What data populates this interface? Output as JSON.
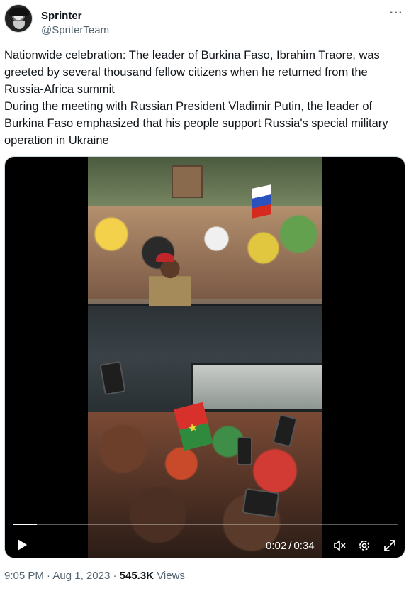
{
  "author": {
    "display_name": "Sprinter",
    "handle": "@SpriterTeam"
  },
  "tweet": {
    "paragraph_1": "Nationwide celebration: The leader of Burkina Faso, Ibrahim Traore, was greeted by several thousand fellow citizens when he returned from the Russia-Africa summit",
    "paragraph_2": "During the meeting with Russian President Vladimir Putin, the leader of Burkina Faso emphasized that his people support Russia's special military operation in Ukraine"
  },
  "video": {
    "current_time": "0:02",
    "separator": "/",
    "duration": "0:34",
    "progress": 0.06,
    "controls": [
      "play-icon",
      "mute-icon",
      "settings-gear-icon",
      "fullscreen-icon"
    ]
  },
  "meta": {
    "time": "9:05 PM",
    "dot1": "·",
    "date": "Aug 1, 2023",
    "dot2": "·",
    "views_count": "545.3K",
    "views_label": "Views"
  },
  "icons": {
    "more": "more-options-icon"
  },
  "colors": {
    "text_primary": "#0f1419",
    "text_secondary": "#536471",
    "media_background": "#000000",
    "border": "#cfd9de"
  }
}
